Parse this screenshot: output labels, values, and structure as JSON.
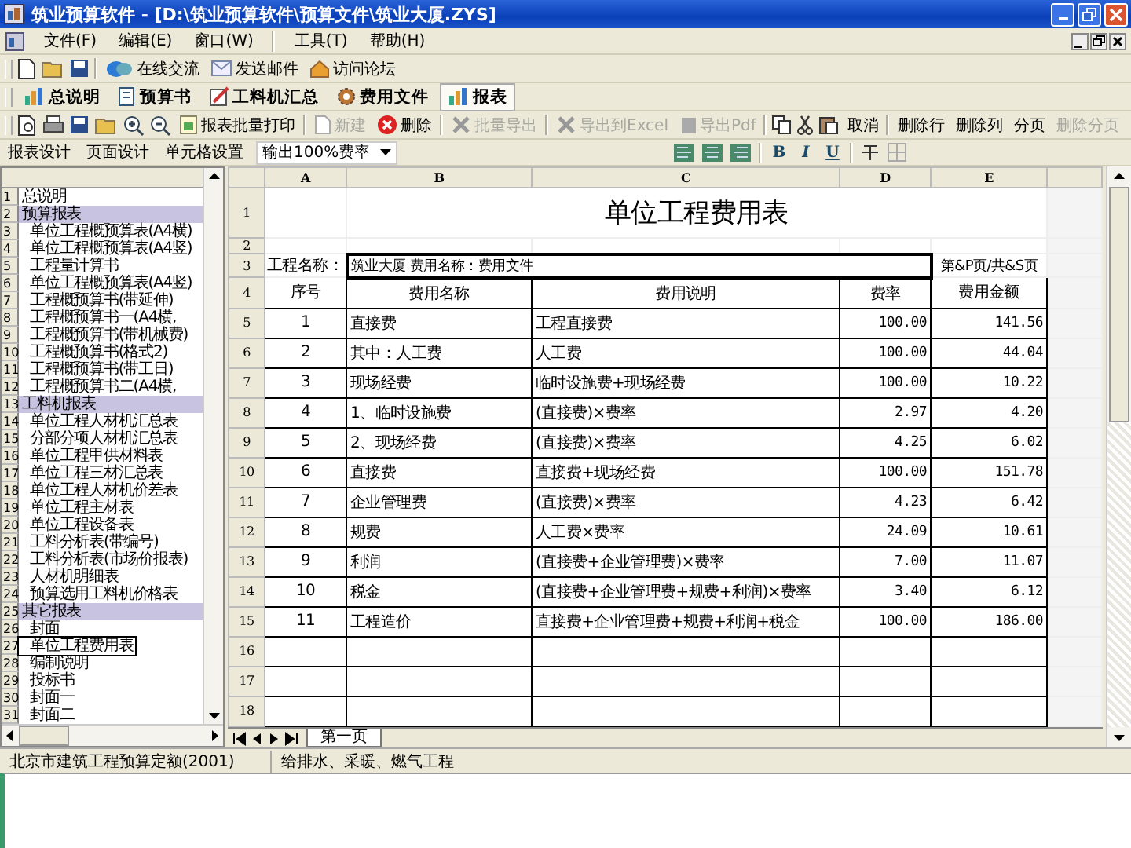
{
  "window": {
    "title": "筑业预算软件 - [D:\\筑业预算软件\\预算文件\\筑业大厦.ZYS]"
  },
  "menu": [
    "文件(F)",
    "编辑(E)",
    "窗口(W)",
    "工具(T)",
    "帮助(H)"
  ],
  "quick_toolbar": [
    "在线交流",
    "发送邮件",
    "访问论坛"
  ],
  "module_tabs": [
    {
      "label": "总说明",
      "selected": false
    },
    {
      "label": "预算书",
      "selected": false
    },
    {
      "label": "工料机汇总",
      "selected": false
    },
    {
      "label": "费用文件",
      "selected": false
    },
    {
      "label": "报表",
      "selected": true
    }
  ],
  "report_toolbar": [
    {
      "label": "报表批量打印",
      "disabled": false
    },
    {
      "label": "新建",
      "disabled": true
    },
    {
      "label": "删除",
      "disabled": false
    },
    {
      "label": "批量导出",
      "disabled": true
    },
    {
      "label": "导出到Excel",
      "disabled": true
    },
    {
      "label": "导出Pdf",
      "disabled": true
    },
    {
      "label": "取消",
      "disabled": false
    },
    {
      "label": "删除行",
      "disabled": false
    },
    {
      "label": "删除列",
      "disabled": false
    },
    {
      "label": "分页",
      "disabled": false
    },
    {
      "label": "删除分页",
      "disabled": true
    }
  ],
  "design_menu": [
    "报表设计",
    "页面设计",
    "单元格设置"
  ],
  "rate_select": {
    "value": "输出100%费率"
  },
  "format_buttons": [
    "B",
    "I",
    "U"
  ],
  "report_tree": [
    {
      "num": "1",
      "label": "总说明",
      "selected": false
    },
    {
      "num": "2",
      "label": "预算报表",
      "selected": false,
      "children": [
        {
          "num": "3",
          "label": "单位工程概预算表(A4横)",
          "selected": false
        },
        {
          "num": "4",
          "label": "单位工程概预算表(A4竖)",
          "selected": false
        },
        {
          "num": "5",
          "label": "工程量计算书",
          "selected": false
        },
        {
          "num": "6",
          "label": "单位工程概预算表(A4竖)",
          "selected": false
        },
        {
          "num": "7",
          "label": "工程概预算书(带延伸)",
          "selected": false
        },
        {
          "num": "8",
          "label": "工程概预算书一(A4横,",
          "selected": false
        },
        {
          "num": "9",
          "label": "工程概预算书(带机械费)",
          "selected": false
        },
        {
          "num": "10",
          "label": "工程概预算书(格式2)",
          "selected": false
        },
        {
          "num": "11",
          "label": "工程概预算书(带工日)",
          "selected": false
        },
        {
          "num": "12",
          "label": "工程概预算书二(A4横,",
          "selected": false
        }
      ]
    },
    {
      "num": "13",
      "label": "工料机报表",
      "selected": false,
      "children": [
        {
          "num": "14",
          "label": "单位工程人材机汇总表",
          "selected": false
        },
        {
          "num": "15",
          "label": "分部分项人材机汇总表",
          "selected": false
        },
        {
          "num": "16",
          "label": "单位工程甲供材料表",
          "selected": false
        },
        {
          "num": "17",
          "label": "单位工程三材汇总表",
          "selected": false
        },
        {
          "num": "18",
          "label": "单位工程人材机价差表",
          "selected": false
        },
        {
          "num": "19",
          "label": "单位工程主材表",
          "selected": false
        },
        {
          "num": "20",
          "label": "单位工程设备表",
          "selected": false
        },
        {
          "num": "21",
          "label": "工料分析表(带编号)",
          "selected": false
        },
        {
          "num": "22",
          "label": "工料分析表(市场价报表)",
          "selected": false
        },
        {
          "num": "23",
          "label": "人材机明细表",
          "selected": false
        },
        {
          "num": "24",
          "label": "预算选用工料机价格表",
          "selected": false
        }
      ]
    },
    {
      "num": "25",
      "label": "其它报表",
      "selected": false,
      "children": [
        {
          "num": "26",
          "label": "封面",
          "selected": false
        },
        {
          "num": "27",
          "label": "单位工程费用表",
          "selected": true
        },
        {
          "num": "28",
          "label": "编制说明",
          "selected": false
        },
        {
          "num": "29",
          "label": "投标书",
          "selected": false
        },
        {
          "num": "30",
          "label": "封面一",
          "selected": false
        },
        {
          "num": "31",
          "label": "封面二",
          "selected": false
        }
      ]
    }
  ],
  "sheet": {
    "columns": [
      "A",
      "B",
      "C",
      "D",
      "E"
    ],
    "row_numbers": [
      "1",
      "2",
      "3",
      "4",
      "5",
      "6",
      "7",
      "8",
      "9",
      "10",
      "11",
      "12",
      "13",
      "14",
      "15",
      "16",
      "17",
      "18"
    ],
    "title": "单位工程费用表",
    "project_label": "工程名称：",
    "project_value": "筑业大厦 费用名称：费用文件",
    "page_info": "第&P页/共&S页",
    "header": [
      "序号",
      "费用名称",
      "费用说明",
      "费率",
      "费用金额"
    ],
    "rows": [
      [
        "1",
        "直接费",
        "工程直接费",
        "100.00",
        "141.56"
      ],
      [
        "2",
        "其中：人工费",
        "人工费",
        "100.00",
        "44.04"
      ],
      [
        "3",
        "现场经费",
        "临时设施费+现场经费",
        "100.00",
        "10.22"
      ],
      [
        "4",
        "1、临时设施费",
        "(直接费)×费率",
        "2.97",
        "4.20"
      ],
      [
        "5",
        "2、现场经费",
        "(直接费)×费率",
        "4.25",
        "6.02"
      ],
      [
        "6",
        "直接费",
        "直接费+现场经费",
        "100.00",
        "151.78"
      ],
      [
        "7",
        "企业管理费",
        "(直接费)×费率",
        "4.23",
        "6.42"
      ],
      [
        "8",
        "规费",
        "人工费×费率",
        "24.09",
        "10.61"
      ],
      [
        "9",
        "利润",
        "(直接费+企业管理费)×费率",
        "7.00",
        "11.07"
      ],
      [
        "10",
        "税金",
        "(直接费+企业管理费+规费+利润)×费率",
        "3.40",
        "6.12"
      ],
      [
        "11",
        "工程造价",
        "直接费+企业管理费+规费+利润+税金",
        "100.00",
        "186.00"
      ]
    ]
  },
  "sheet_tabs": [
    {
      "label": "第一页",
      "selected": true
    }
  ],
  "status_bar": [
    "北京市建筑工程预算定额(2001)",
    "给排水、采暖、燃气工程"
  ]
}
